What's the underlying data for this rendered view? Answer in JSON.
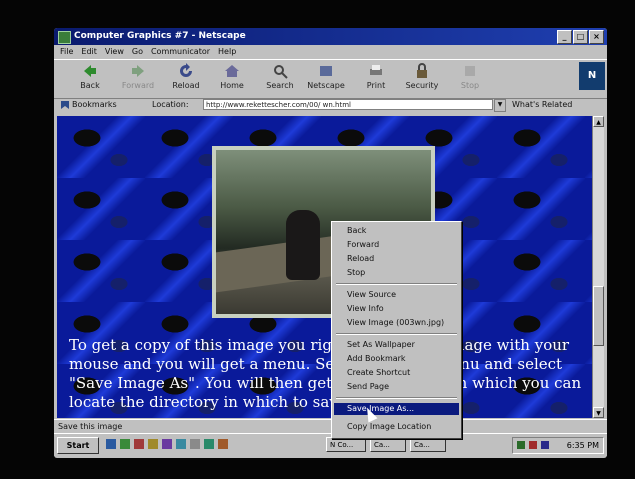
{
  "window": {
    "title": "Computer Graphics #7 - Netscape",
    "buttons": [
      "_",
      "□",
      "×"
    ]
  },
  "menubar": [
    "File",
    "Edit",
    "View",
    "Go",
    "Communicator",
    "Help"
  ],
  "toolbar": {
    "back": "Back",
    "forward": "Forward",
    "reload": "Reload",
    "home": "Home",
    "search": "Search",
    "netscape": "Netscape",
    "print": "Print",
    "security": "Security",
    "stop": "Stop",
    "brand": "N"
  },
  "location": {
    "bookmarks": "Bookmarks",
    "label": "Location:",
    "url": "http://www.rekettescher.com/00/ wn.html",
    "related": "What's Related"
  },
  "content": {
    "text": "To get a copy of this image you right click on the image with your mouse and you will get a menu. Select from the menu and select \"Save Image As\". You will then get a dialog box with which you can locate the directory in which to save the image."
  },
  "context_menu": {
    "items": [
      {
        "label": "Back",
        "group": 1
      },
      {
        "label": "Forward",
        "group": 1
      },
      {
        "label": "Reload",
        "group": 1
      },
      {
        "label": "Stop",
        "group": 1
      },
      {
        "label": "View Source",
        "group": 2
      },
      {
        "label": "View Info",
        "group": 2
      },
      {
        "label": "View Image (003wn.jpg)",
        "group": 2
      },
      {
        "label": "Set As Wallpaper",
        "group": 3
      },
      {
        "label": "Add Bookmark",
        "group": 3
      },
      {
        "label": "Create Shortcut",
        "group": 3
      },
      {
        "label": "Send Page",
        "group": 3
      },
      {
        "label": "Save Image As...",
        "group": 4,
        "selected": true
      },
      {
        "label": "Copy Image Location",
        "group": 4
      }
    ]
  },
  "statusbar": {
    "text": "Save this image"
  },
  "taskbar": {
    "start": "Start",
    "tasks": [
      "N Co...",
      "Ca...",
      "Ca..."
    ],
    "clock": "6:35 PM"
  },
  "colors": {
    "title_bar": "#0a1a6e",
    "menu_highlight": "#0a1a7e",
    "page_background": "#0a1a9a"
  }
}
